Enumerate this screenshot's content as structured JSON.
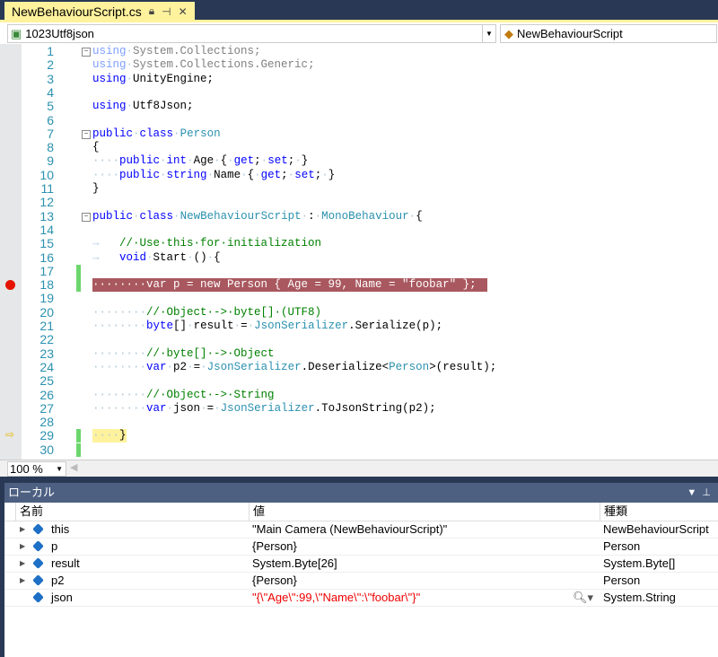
{
  "tab": {
    "title": "NewBehaviourScript.cs",
    "pin_icon": "pin-icon",
    "close": "✕"
  },
  "nav": {
    "project": "1023Utf8json",
    "class": "NewBehaviourScript"
  },
  "editor": {
    "breakpoint_line": 18,
    "current_line": 29,
    "lines": [
      [
        [
          "kwd",
          "using"
        ],
        [
          "ws",
          "·"
        ],
        [
          "gr",
          "System.Collections;"
        ]
      ],
      [
        [
          "kwd",
          "using"
        ],
        [
          "ws",
          "·"
        ],
        [
          "gr",
          "System.Collections.Generic;"
        ]
      ],
      [
        [
          "kw",
          "using"
        ],
        [
          "ws",
          "·"
        ],
        [
          "pl",
          "UnityEngine;"
        ]
      ],
      [],
      [
        [
          "kw",
          "using"
        ],
        [
          "ws",
          "·"
        ],
        [
          "pl",
          "Utf8Json;"
        ]
      ],
      [],
      [
        [
          "kw",
          "public"
        ],
        [
          "ws",
          "·"
        ],
        [
          "kw",
          "class"
        ],
        [
          "ws",
          "·"
        ],
        [
          "ty",
          "Person"
        ]
      ],
      [
        [
          "pl",
          "{"
        ]
      ],
      [
        [
          "ws",
          "····"
        ],
        [
          "kw",
          "public"
        ],
        [
          "ws",
          "·"
        ],
        [
          "kw",
          "int"
        ],
        [
          "ws",
          "·"
        ],
        [
          "pl",
          "Age"
        ],
        [
          "ws",
          "·"
        ],
        [
          "pl",
          "{"
        ],
        [
          "ws",
          "·"
        ],
        [
          "kw",
          "get"
        ],
        [
          "pl",
          ";"
        ],
        [
          "ws",
          "·"
        ],
        [
          "kw",
          "set"
        ],
        [
          "pl",
          ";"
        ],
        [
          "ws",
          "·"
        ],
        [
          "pl",
          "}"
        ]
      ],
      [
        [
          "ws",
          "····"
        ],
        [
          "kw",
          "public"
        ],
        [
          "ws",
          "·"
        ],
        [
          "kw",
          "string"
        ],
        [
          "ws",
          "·"
        ],
        [
          "pl",
          "Name"
        ],
        [
          "ws",
          "·"
        ],
        [
          "pl",
          "{"
        ],
        [
          "ws",
          "·"
        ],
        [
          "kw",
          "get"
        ],
        [
          "pl",
          ";"
        ],
        [
          "ws",
          "·"
        ],
        [
          "kw",
          "set"
        ],
        [
          "pl",
          ";"
        ],
        [
          "ws",
          "·"
        ],
        [
          "pl",
          "}"
        ]
      ],
      [
        [
          "pl",
          "}"
        ]
      ],
      [],
      [
        [
          "kw",
          "public"
        ],
        [
          "ws",
          "·"
        ],
        [
          "kw",
          "class"
        ],
        [
          "ws",
          "·"
        ],
        [
          "ty",
          "NewBehaviourScript"
        ],
        [
          "ws",
          "·"
        ],
        [
          "pl",
          ":"
        ],
        [
          "ws",
          "·"
        ],
        [
          "ty",
          "MonoBehaviour"
        ],
        [
          "ws",
          "·"
        ],
        [
          "pl",
          "{"
        ]
      ],
      [],
      [
        [
          "ws",
          "→   "
        ],
        [
          "cm",
          "//·Use·this·for·initialization"
        ]
      ],
      [
        [
          "ws",
          "→   "
        ],
        [
          "kw",
          "void"
        ],
        [
          "ws",
          "·"
        ],
        [
          "pl",
          "Start"
        ],
        [
          "ws",
          "·"
        ],
        [
          "pl",
          "()"
        ],
        [
          "ws",
          "·"
        ],
        [
          "pl",
          "{"
        ]
      ],
      [],
      [
        [
          "ws",
          "········"
        ],
        [
          "pl",
          "var p = new Person { Age = 99, Name = \"foobar\" };"
        ]
      ],
      [],
      [
        [
          "ws",
          "········"
        ],
        [
          "cm",
          "//·Object·->·byte[]·(UTF8)"
        ]
      ],
      [
        [
          "ws",
          "········"
        ],
        [
          "kw",
          "byte"
        ],
        [
          "pl",
          "[]"
        ],
        [
          "ws",
          "·"
        ],
        [
          "pl",
          "result"
        ],
        [
          "ws",
          "·"
        ],
        [
          "pl",
          "="
        ],
        [
          "ws",
          "·"
        ],
        [
          "ty",
          "JsonSerializer"
        ],
        [
          "pl",
          ".Serialize(p);"
        ]
      ],
      [],
      [
        [
          "ws",
          "········"
        ],
        [
          "cm",
          "//·byte[]·->·Object"
        ]
      ],
      [
        [
          "ws",
          "········"
        ],
        [
          "kw",
          "var"
        ],
        [
          "ws",
          "·"
        ],
        [
          "pl",
          "p2"
        ],
        [
          "ws",
          "·"
        ],
        [
          "pl",
          "="
        ],
        [
          "ws",
          "·"
        ],
        [
          "ty",
          "JsonSerializer"
        ],
        [
          "pl",
          ".Deserialize<"
        ],
        [
          "ty",
          "Person"
        ],
        [
          "pl",
          ">(result);"
        ]
      ],
      [],
      [
        [
          "ws",
          "········"
        ],
        [
          "cm",
          "//·Object·->·String"
        ]
      ],
      [
        [
          "ws",
          "········"
        ],
        [
          "kw",
          "var"
        ],
        [
          "ws",
          "·"
        ],
        [
          "pl",
          "json"
        ],
        [
          "ws",
          "·"
        ],
        [
          "pl",
          "="
        ],
        [
          "ws",
          "·"
        ],
        [
          "ty",
          "JsonSerializer"
        ],
        [
          "pl",
          ".ToJsonString(p2);"
        ]
      ],
      [],
      [
        [
          "ws",
          "····"
        ],
        [
          "pl",
          "}"
        ]
      ],
      []
    ]
  },
  "zoom": {
    "value": "100 %"
  },
  "locals": {
    "title": "ローカル",
    "columns": [
      "名前",
      "値",
      "種類"
    ],
    "rows": [
      {
        "name": "this",
        "value": "\"Main Camera (NewBehaviourScript)\"",
        "type": "NewBehaviourScript",
        "expandable": true,
        "changed": false
      },
      {
        "name": "p",
        "value": "{Person}",
        "type": "Person",
        "expandable": true,
        "changed": false
      },
      {
        "name": "result",
        "value": "System.Byte[26]",
        "type": "System.Byte[]",
        "expandable": true,
        "changed": false
      },
      {
        "name": "p2",
        "value": "{Person}",
        "type": "Person",
        "expandable": true,
        "changed": false
      },
      {
        "name": "json",
        "value": "\"{\\\"Age\\\":99,\\\"Name\\\":\\\"foobar\\\"}\"",
        "type": "System.String",
        "expandable": false,
        "changed": true
      }
    ],
    "changed_color": "#E00000"
  }
}
